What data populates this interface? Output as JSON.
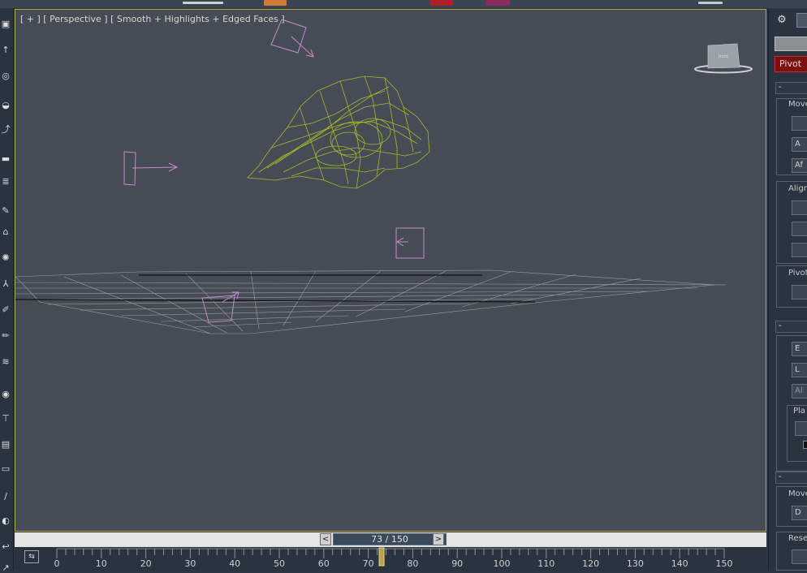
{
  "viewport": {
    "label": "[ + ] [ Perspective ] [ Smooth + Highlights + Edged Faces ]",
    "viewcube_text": "front"
  },
  "timeline": {
    "frame_display": "73 / 150",
    "prev_label": "<",
    "next_label": ">",
    "current_frame": 73,
    "total_frames": 150,
    "ticks": [
      "0",
      "10",
      "20",
      "30",
      "40",
      "50",
      "60",
      "70",
      "80",
      "90",
      "100",
      "110",
      "120",
      "130",
      "140",
      "150"
    ]
  },
  "right_panel": {
    "pivot_button": "Pivot",
    "move_label": "Move",
    "align_label": "Align",
    "pivot_label": "Pivot",
    "place_label": "Pla",
    "move_label_2": "Move",
    "reset_label": "Rese",
    "btn_a": "A",
    "btn_af": "Af",
    "btn_e": "E",
    "btn_l": "L",
    "btn_al": "Al",
    "btn_d": "D",
    "minus": "-"
  },
  "colors": {
    "viewport_bg": "#464c55",
    "active_border": "#b8a24a",
    "mesh": "#a6b82a",
    "helper": "#c58ac9",
    "grid": "#a8acb2",
    "pivot_red": "#7a1010"
  }
}
